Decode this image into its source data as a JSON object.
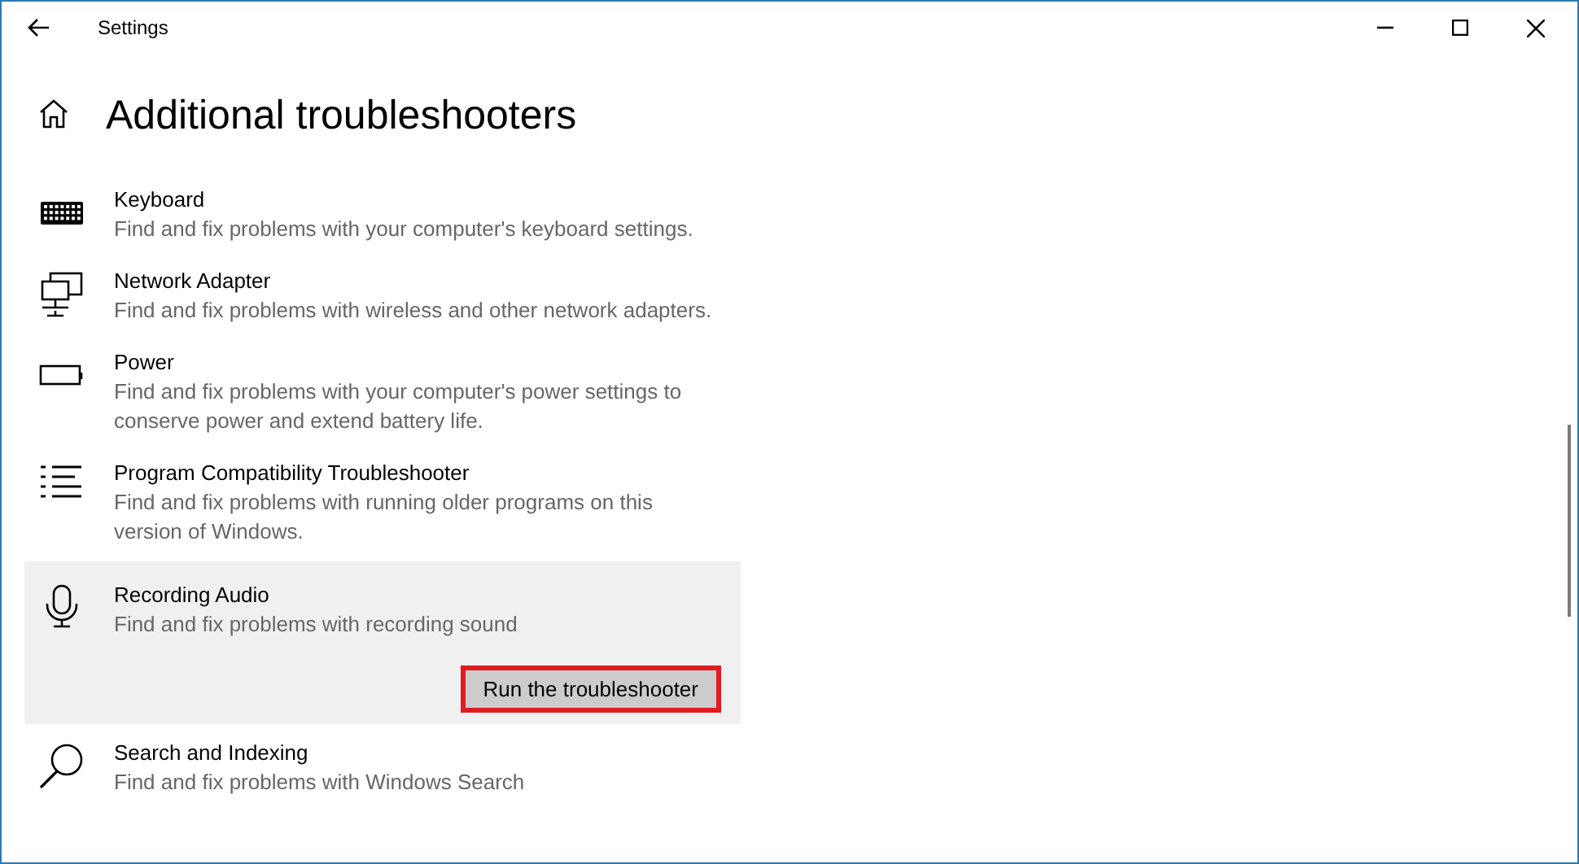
{
  "window": {
    "title": "Settings"
  },
  "page": {
    "title": "Additional troubleshooters"
  },
  "troubleshooters": [
    {
      "kind": "keyboard",
      "name": "Keyboard",
      "description": "Find and fix problems with your computer's keyboard settings.",
      "selected": false
    },
    {
      "kind": "network",
      "name": "Network Adapter",
      "description": "Find and fix problems with wireless and other network adapters.",
      "selected": false
    },
    {
      "kind": "battery",
      "name": "Power",
      "description": "Find and fix problems with your computer's power settings to conserve power and extend battery life.",
      "selected": false
    },
    {
      "kind": "list",
      "name": "Program Compatibility Troubleshooter",
      "description": "Find and fix problems with running older programs on this version of Windows.",
      "selected": false
    },
    {
      "kind": "microphone",
      "name": "Recording Audio",
      "description": "Find and fix problems with recording sound",
      "selected": true,
      "button": {
        "label": "Run the troubleshooter",
        "highlighted": true
      }
    },
    {
      "kind": "search",
      "name": "Search and Indexing",
      "description": "Find and fix problems with Windows Search",
      "selected": false
    }
  ]
}
